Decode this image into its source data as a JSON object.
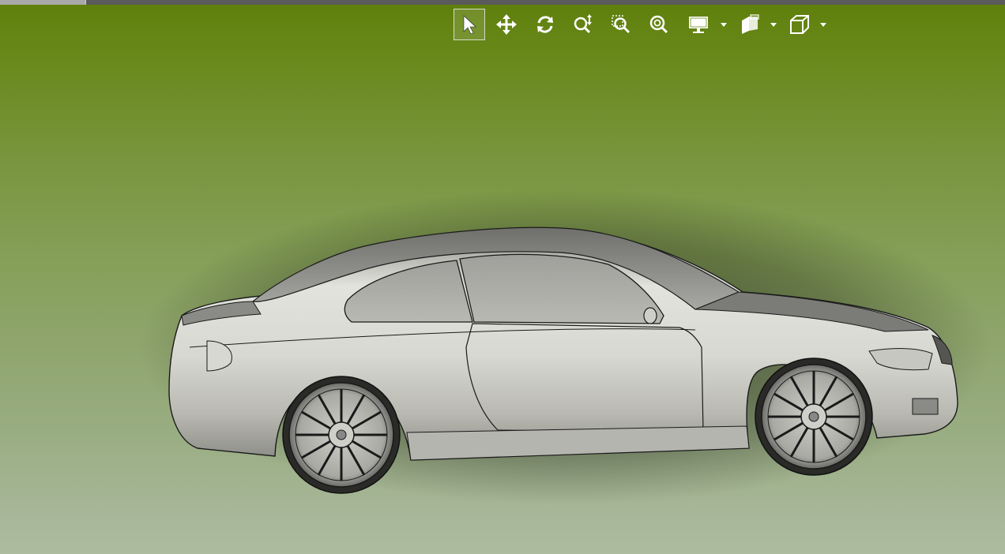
{
  "viewer": {
    "colors": {
      "background_top": "#5f7f0b",
      "background_bottom": "#adbb9f",
      "icon": "#ffffff",
      "active_border": "#d5dbc6"
    },
    "toolbar": {
      "tools": [
        {
          "icon": "select-arrow-icon",
          "active": true
        },
        {
          "icon": "pan-move-icon",
          "active": false
        },
        {
          "icon": "rotate-icon",
          "active": false
        },
        {
          "icon": "zoom-icon",
          "active": false
        },
        {
          "icon": "zoom-window-icon",
          "active": false
        },
        {
          "icon": "zoom-fit-icon",
          "active": false
        },
        {
          "icon": "display-mode-icon",
          "active": false,
          "dropdown": true
        },
        {
          "icon": "section-view-icon",
          "active": false,
          "dropdown": true
        },
        {
          "icon": "view-orientation-cube-icon",
          "active": false,
          "dropdown": true
        }
      ]
    },
    "model": {
      "subject": "car-side-view",
      "shading": "shaded-with-edges"
    }
  }
}
